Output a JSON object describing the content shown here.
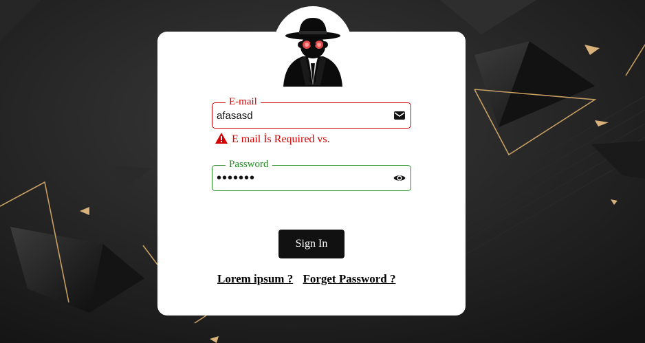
{
  "colors": {
    "background": "#1c1c1c",
    "gold_accent": "#c9a064",
    "error_red": "#d20000",
    "success_green": "#1f8a1f",
    "button_dark": "#111111"
  },
  "avatar": {
    "icon": "spy-agent-icon"
  },
  "email": {
    "label": "E-mail",
    "value": "afasasd",
    "icon": "envelope-icon",
    "error": "E mail İs Required vs.",
    "error_icon": "warning-icon"
  },
  "password": {
    "label": "Password",
    "value": "1234567",
    "icon": "eye-icon"
  },
  "signin_label": "Sign In",
  "links": {
    "lorem": "Lorem ipsum ?",
    "forget": "Forget Password ?"
  }
}
